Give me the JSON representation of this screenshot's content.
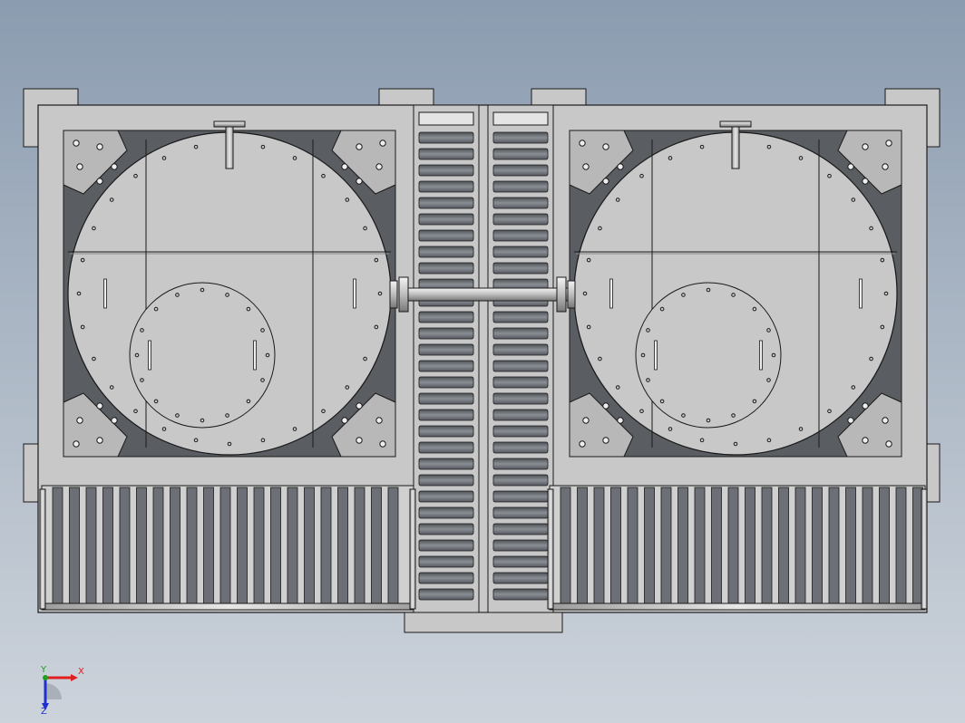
{
  "viewport": {
    "model_fill": "#c8c8c8",
    "edge_color": "#1a1a1a",
    "dark_fill": "#5a5d62",
    "slot_fill": "#6c7076"
  },
  "triad": {
    "x_label": "X",
    "y_label": "Y",
    "z_label": "Z",
    "x_color": "#e02020",
    "y_color": "#20a020",
    "z_color": "#2030d0"
  }
}
